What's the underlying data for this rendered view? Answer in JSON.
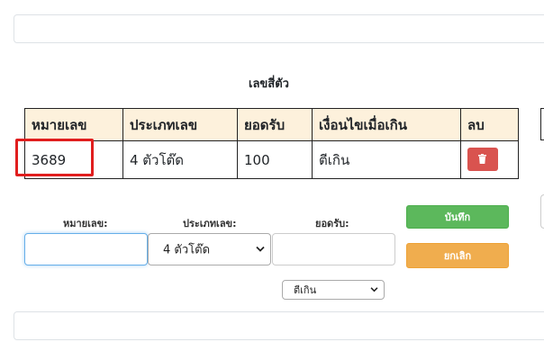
{
  "section_title": "เลขสี่ตัว",
  "table": {
    "headers": [
      "หมายเลข",
      "ประเภทเลข",
      "ยอดรับ",
      "เงื่อนไขเมื่อเกิน",
      "ลบ"
    ],
    "rows": [
      {
        "number": "3689",
        "type": "4 ตัวโต๊ด",
        "amount": "100",
        "condition": "ตีเกิน"
      }
    ]
  },
  "form": {
    "number_label": "หมายเลข:",
    "number_value": "",
    "type_label": "ประเภทเลข:",
    "type_selected": "4 ตัวโต๊ด",
    "amount_label": "ยอดรับ:",
    "amount_value": "",
    "condition_selected": "ตีเกิน",
    "save_label": "บันทึก",
    "cancel_label": "ยกเลิก"
  },
  "colors": {
    "header_bg": "#fdf1dc",
    "delete_button": "#d9534f",
    "save_button": "#5cb85c",
    "cancel_button": "#f0ad4e",
    "highlight_box": "#e01e1e"
  },
  "icons": {
    "delete": "trash-icon",
    "dropdown": "chevron-down-icon"
  }
}
